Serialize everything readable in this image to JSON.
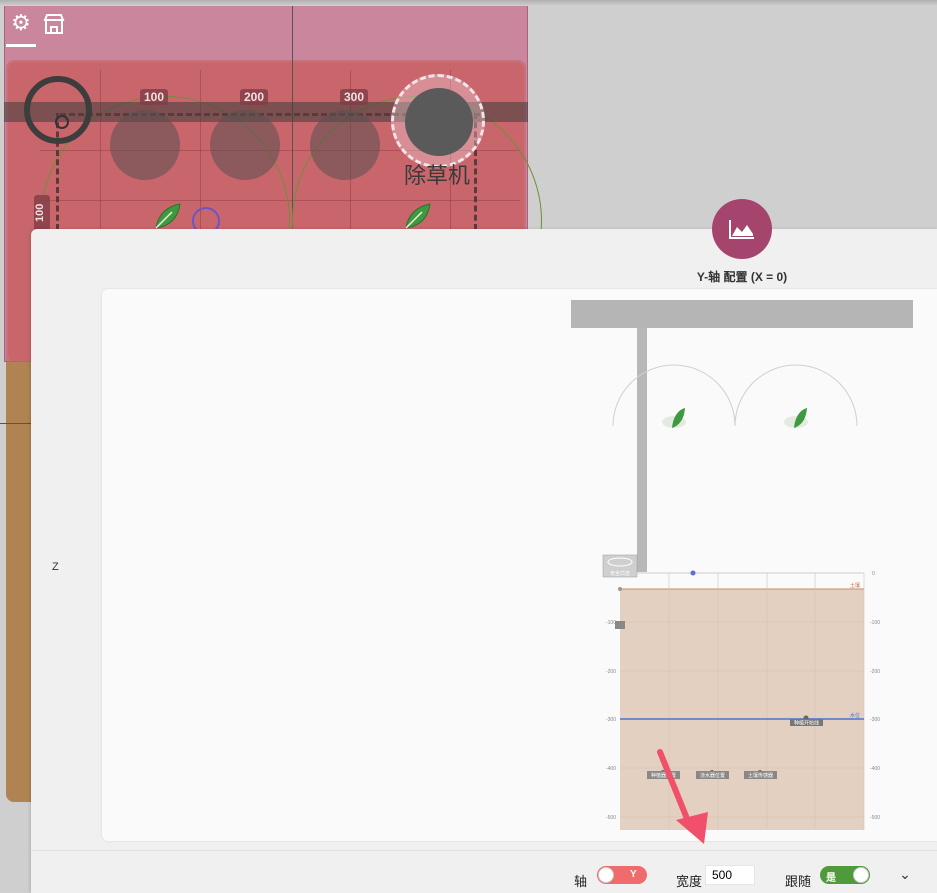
{
  "map": {
    "tick_labels": [
      "100",
      "200",
      "300"
    ],
    "side_label": "100",
    "tool_name": "除草机",
    "axis_hint": "X",
    "top_icons": [
      "gear-icon",
      "store-icon"
    ]
  },
  "panel": {
    "icon": "area-chart-icon",
    "title": "Y-轴 配置 (X = 0)",
    "z_label": "Z",
    "accent_color": "#a5456d"
  },
  "canvas": {
    "soil_color": "#e3d0c0",
    "soil_top_label": "土壤",
    "water_label": "水位",
    "y_ticks_right": [
      "0",
      "-100",
      "-200",
      "-300",
      "-400",
      "-500"
    ],
    "y_ticks_left": [
      "-100",
      "-200",
      "-300",
      "-400",
      "-500"
    ],
    "markers": [
      {
        "label": "种植开始线",
        "depth": -300
      },
      {
        "label": "种植器位置",
        "depth": -400
      },
      {
        "label": "浇水器位置",
        "depth": -400
      },
      {
        "label": "土壤传感器",
        "depth": -400
      }
    ],
    "tool_badge": "安全高度"
  },
  "bottombar": {
    "axis_label": "轴",
    "axis_toggle": "Y",
    "width_label": "宽度",
    "width_value": "500",
    "follow_label": "跟随",
    "follow_toggle": "是",
    "axis_toggle_color": "#f06b6b",
    "follow_toggle_color": "#4f9a3a"
  }
}
